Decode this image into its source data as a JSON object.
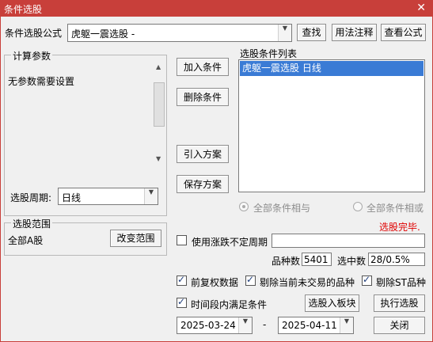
{
  "window": {
    "title": "条件选股",
    "close_glyph": "✕"
  },
  "formula": {
    "label": "条件选股公式",
    "selected": "虎躯一震选股  -",
    "find_button": "查找",
    "usage_button": "用法注释",
    "view_button": "查看公式"
  },
  "params": {
    "legend": "计算参数",
    "text": "无参数需要设置",
    "period_label": "选股周期:",
    "period_value": "日线"
  },
  "actions": {
    "add": "加入条件",
    "delete": "删除条件",
    "import": "引入方案",
    "save": "保存方案"
  },
  "condition_list": {
    "label": "选股条件列表",
    "items": [
      "虎躯一震选股  日线"
    ]
  },
  "logic": {
    "and_label": "全部条件相与",
    "or_label": "全部条件相或"
  },
  "status": {
    "text": "选股完毕.",
    "color": "#e00000"
  },
  "scope": {
    "legend": "选股范围",
    "value": "全部A股",
    "change_button": "改变范围"
  },
  "options": {
    "use_limit_period": "使用涨跌不定周期",
    "stock_count_label": "品种数",
    "stock_count": "5401",
    "selected_label": "选中数",
    "selected_value": "28/0.5%",
    "forward_adjust": "前复权数据",
    "exclude_untraded": "剔除当前未交易的品种",
    "exclude_st": "剔除ST品种",
    "time_range": "时间段内满足条件"
  },
  "buttons": {
    "to_block": "选股入板块",
    "run": "执行选股",
    "close": "关闭"
  },
  "dates": {
    "start": "2025-03-24",
    "separator": "-",
    "end": "2025-04-11"
  },
  "colors": {
    "titlebar": "#c83f3a",
    "selection": "#3a7bd5"
  }
}
